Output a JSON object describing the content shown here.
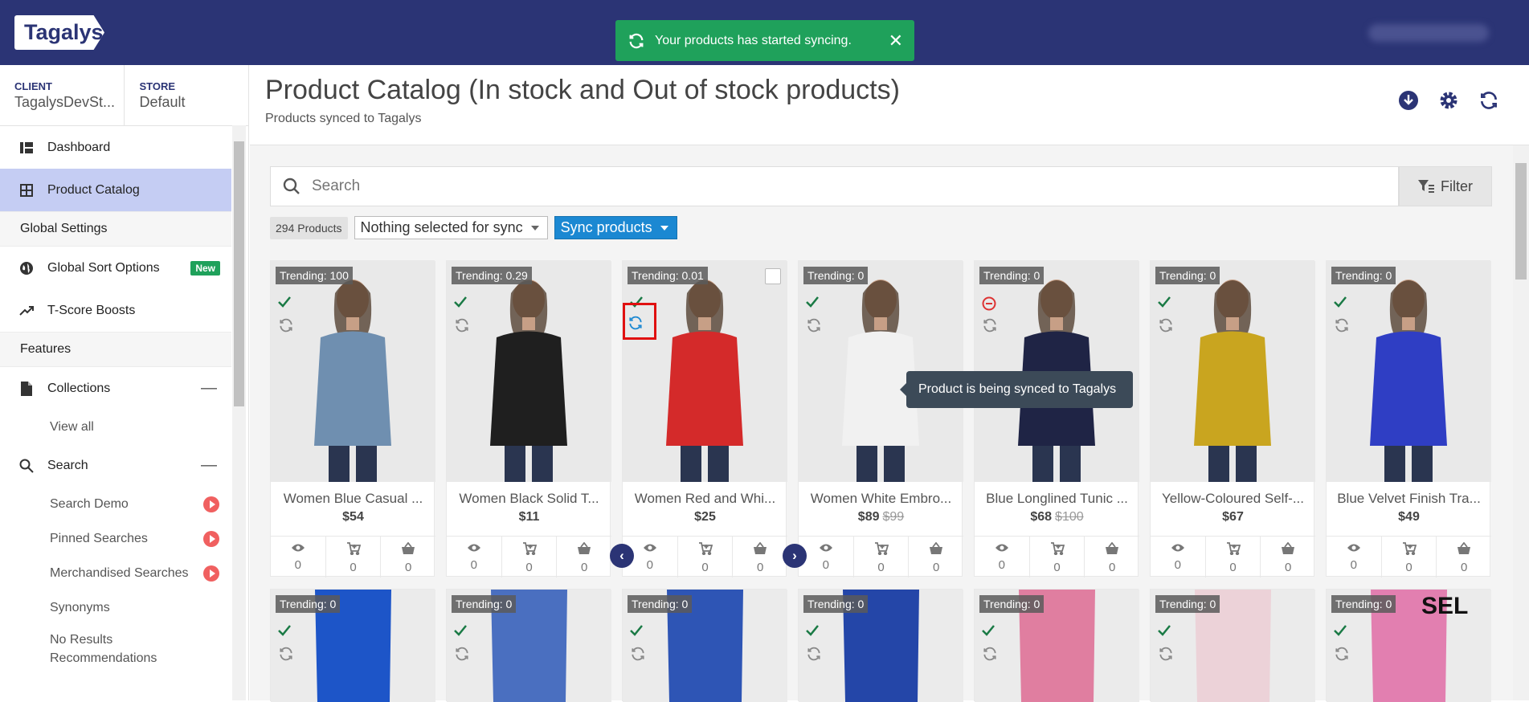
{
  "app": {
    "logo": "Tagalys"
  },
  "toast": {
    "message": "Your products has started syncing.",
    "close": "✕"
  },
  "context": {
    "client_label": "CLIENT",
    "client_value": "TagalysDevSt...",
    "store_label": "STORE",
    "store_value": "Default"
  },
  "sidebar": {
    "dashboard": "Dashboard",
    "product_catalog": "Product Catalog",
    "global_settings": "Global Settings",
    "global_sort": "Global Sort Options",
    "new_badge": "New",
    "tscore": "T-Score Boosts",
    "features": "Features",
    "collections": "Collections",
    "view_all": "View all",
    "search": "Search",
    "search_demo": "Search Demo",
    "pinned": "Pinned Searches",
    "merch": "Merchandised Searches",
    "synonyms": "Synonyms",
    "no_results_1": "No Results",
    "no_results_2": "Recommendations",
    "collapse_symbol": "—"
  },
  "header": {
    "title": "Product Catalog (In stock and Out of stock products)",
    "subtitle": "Products synced to Tagalys"
  },
  "search": {
    "placeholder": "Search",
    "filter_label": "Filter"
  },
  "toolbar": {
    "count": "294 Products",
    "sync_select": "Nothing selected for sync",
    "sync_button": "Sync products"
  },
  "tooltip": {
    "text": "Product is being synced to Tagalys"
  },
  "colors": {
    "brand": "#2b3475",
    "success": "#1fa15b",
    "accent": "#1b88d2",
    "highlight": "#e01010"
  },
  "products": [
    {
      "trending": "Trending: 100",
      "name": "Women Blue Casual ...",
      "price": "$54",
      "was": "",
      "status": "check",
      "views": "0",
      "carts": "0",
      "buys": "0",
      "color": "#6f8fb0"
    },
    {
      "trending": "Trending: 0.29",
      "name": "Women Black Solid T...",
      "price": "$11",
      "was": "",
      "status": "check",
      "views": "0",
      "carts": "0",
      "buys": "0",
      "color": "#1f1f1f"
    },
    {
      "trending": "Trending: 0.01",
      "name": "Women Red and Whi...",
      "price": "$25",
      "was": "",
      "status": "check",
      "views": "0",
      "carts": "0",
      "buys": "0",
      "color": "#d42a2a"
    },
    {
      "trending": "Trending: 0",
      "name": "Women White Embro...",
      "price": "$89",
      "was": "$99",
      "status": "check",
      "views": "0",
      "carts": "0",
      "buys": "0",
      "color": "#f1f1f1"
    },
    {
      "trending": "Trending: 0",
      "name": "Blue Longlined Tunic ...",
      "price": "$68",
      "was": "$100",
      "status": "minus",
      "views": "0",
      "carts": "0",
      "buys": "0",
      "color": "#1f2445"
    },
    {
      "trending": "Trending: 0",
      "name": "Yellow-Coloured Self-...",
      "price": "$67",
      "was": "",
      "status": "check",
      "views": "0",
      "carts": "0",
      "buys": "0",
      "color": "#c9a51f"
    },
    {
      "trending": "Trending: 0",
      "name": "Blue Velvet Finish Tra...",
      "price": "$49",
      "was": "",
      "status": "check",
      "views": "0",
      "carts": "0",
      "buys": "0",
      "color": "#2f3ec4"
    }
  ],
  "products_row2": [
    {
      "trending": "Trending: 0",
      "color": "#1d55c8"
    },
    {
      "trending": "Trending: 0",
      "color": "#4a6fc0"
    },
    {
      "trending": "Trending: 0",
      "color": "#2e55b5"
    },
    {
      "trending": "Trending: 0",
      "color": "#2446a8"
    },
    {
      "trending": "Trending: 0",
      "color": "#e07ea0"
    },
    {
      "trending": "Trending: 0",
      "color": "#ecd2d8"
    },
    {
      "trending": "Trending: 0",
      "color": "#e27fb0"
    }
  ],
  "row2_badge_text": "SEL"
}
